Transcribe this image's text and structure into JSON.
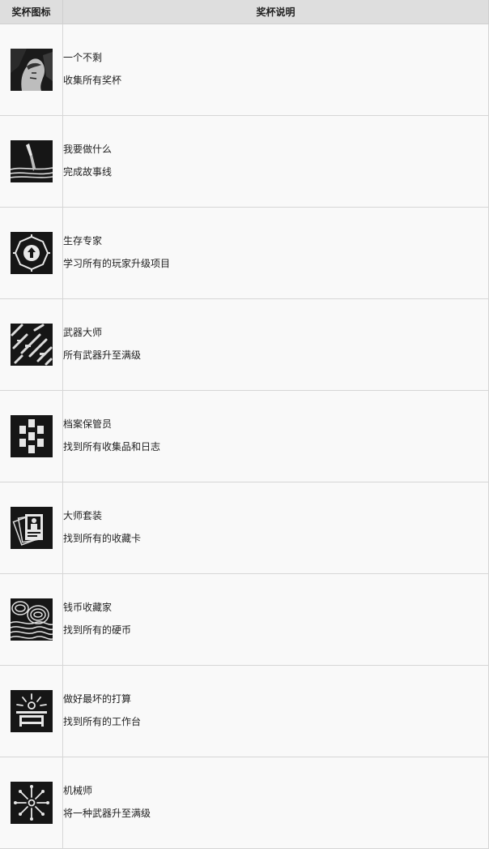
{
  "header": {
    "icon_col": "奖杯图标",
    "desc_col": "奖杯说明"
  },
  "trophies": [
    {
      "name": "一个不剩",
      "desc": "收集所有奖杯",
      "icon": "portrait-icon"
    },
    {
      "name": "我要做什么",
      "desc": "完成故事线",
      "icon": "knife-icon"
    },
    {
      "name": "生存专家",
      "desc": "学习所有的玩家升级项目",
      "icon": "upgrade-gear-icon"
    },
    {
      "name": "武器大师",
      "desc": "所有武器升至满级",
      "icon": "weapons-icon"
    },
    {
      "name": "档案保管员",
      "desc": "找到所有收集品和日志",
      "icon": "documents-icon"
    },
    {
      "name": "大师套装",
      "desc": "找到所有的收藏卡",
      "icon": "cards-icon"
    },
    {
      "name": "钱币收藏家",
      "desc": "找到所有的硬币",
      "icon": "coins-icon"
    },
    {
      "name": "做好最坏的打算",
      "desc": "找到所有的工作台",
      "icon": "workbench-icon"
    },
    {
      "name": "机械师",
      "desc": "将一种武器升至满级",
      "icon": "tools-icon"
    }
  ]
}
